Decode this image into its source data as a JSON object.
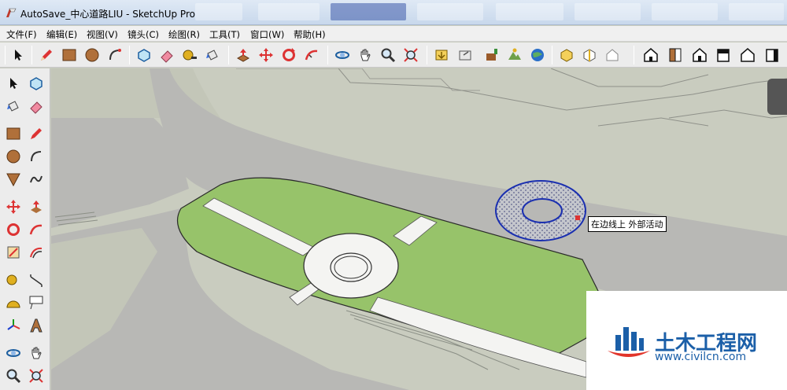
{
  "window": {
    "title": "AutoSave_中心道路LIU - SketchUp Pro"
  },
  "menu": {
    "items": [
      "文件(F)",
      "编辑(E)",
      "视图(V)",
      "镜头(C)",
      "绘图(R)",
      "工具(T)",
      "窗口(W)",
      "帮助(H)"
    ]
  },
  "toolbar": {
    "icons": [
      "select-icon",
      "pencil-icon",
      "rectangle-icon",
      "circle-icon",
      "arc-icon",
      "make-component-icon",
      "eraser-icon",
      "tape-measure-icon",
      "paint-bucket-icon",
      "push-pull-icon",
      "move-icon",
      "rotate-icon",
      "follow-me-icon",
      "orbit-icon",
      "pan-icon",
      "zoom-icon",
      "zoom-extents-icon",
      "get-models-icon",
      "share-model-icon",
      "add-location-icon",
      "toggle-terrain-icon",
      "google-earth-icon",
      "get-components-icon",
      "share-component-icon",
      "warehouse-icon",
      "iso-view-icon",
      "top-view-icon",
      "front-view-icon",
      "right-view-icon",
      "back-view-icon",
      "left-view-icon"
    ]
  },
  "left_toolbar": {
    "icons": [
      "select-icon",
      "make-component-icon",
      "paint-bucket-icon",
      "eraser-icon",
      "rectangle-icon",
      "line-icon",
      "circle-icon",
      "arc-icon",
      "polygon-icon",
      "freehand-icon",
      "move-icon",
      "push-pull-icon",
      "rotate-icon",
      "follow-me-icon",
      "scale-icon",
      "offset-icon",
      "tape-measure-icon",
      "dimension-icon",
      "protractor-icon",
      "text-icon",
      "axes-icon",
      "3d-text-icon",
      "orbit-icon",
      "pan-icon",
      "zoom-icon",
      "zoom-window-icon"
    ]
  },
  "viewport": {
    "tooltip": "在边线上 外部活动"
  },
  "watermark": {
    "name": "土木工程网",
    "url": "www.civilcn.com"
  },
  "colors": {
    "ground": "#c9ccbf",
    "road": "#b8b8b5",
    "lawn": "#97c36a",
    "path": "#f4f4f2",
    "selection": "#1a2fb0",
    "watermark": "#1b5fa8"
  }
}
